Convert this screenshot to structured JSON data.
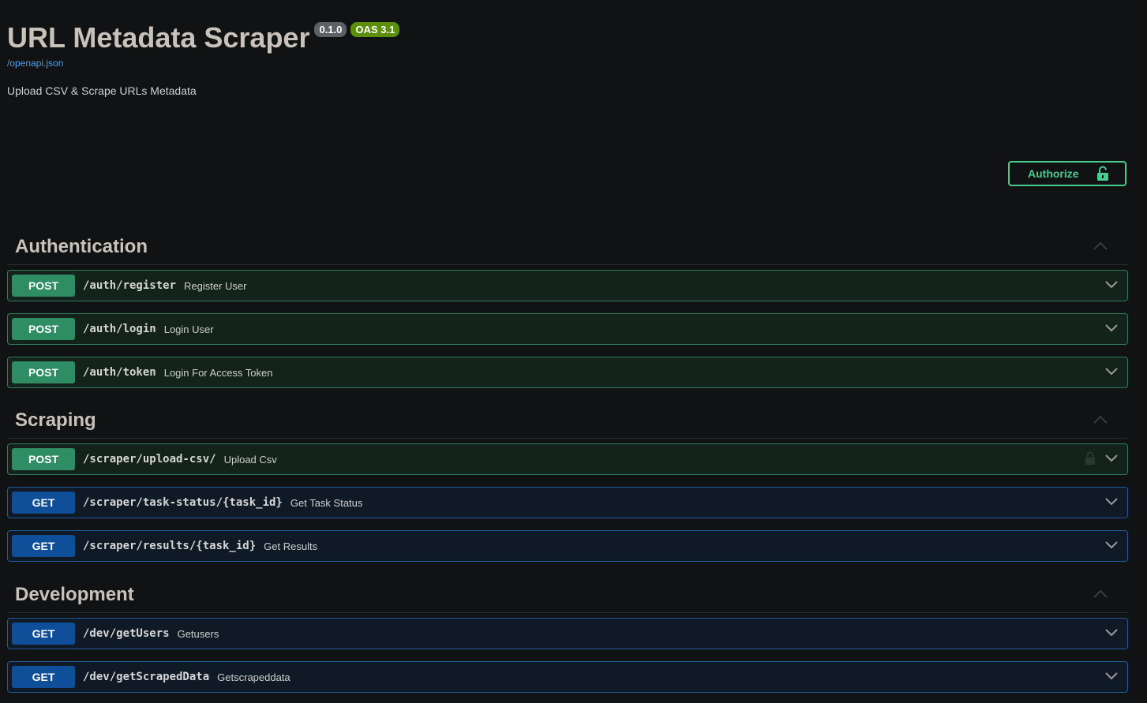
{
  "info": {
    "title": "URL Metadata Scraper",
    "version": "0.1.0",
    "oas": "OAS 3.1",
    "spec_link": "/openapi.json",
    "description": "Upload CSV & Scrape URLs Metadata"
  },
  "authorize": {
    "label": "Authorize",
    "icon": "unlocked-padlock-icon"
  },
  "colors": {
    "post": "#49cc90",
    "get": "#0f4e99",
    "background": "#111213"
  },
  "sections": [
    {
      "title": "Authentication",
      "operations": [
        {
          "method": "POST",
          "path": "/auth/register",
          "summary": "Register User"
        },
        {
          "method": "POST",
          "path": "/auth/login",
          "summary": "Login User"
        },
        {
          "method": "POST",
          "path": "/auth/token",
          "summary": "Login For Access Token"
        }
      ]
    },
    {
      "title": "Scraping",
      "operations": [
        {
          "method": "POST",
          "path": "/scraper/upload-csv/",
          "summary": "Upload Csv",
          "locked": true
        },
        {
          "method": "GET",
          "path": "/scraper/task-status/{task_id}",
          "summary": "Get Task Status"
        },
        {
          "method": "GET",
          "path": "/scraper/results/{task_id}",
          "summary": "Get Results"
        }
      ]
    },
    {
      "title": "Development",
      "operations": [
        {
          "method": "GET",
          "path": "/dev/getUsers",
          "summary": "Getusers"
        },
        {
          "method": "GET",
          "path": "/dev/getScrapedData",
          "summary": "Getscrapeddata"
        }
      ]
    }
  ]
}
